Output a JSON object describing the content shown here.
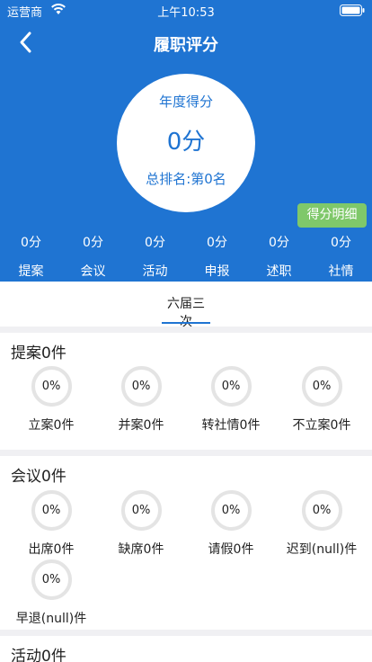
{
  "status": {
    "carrier": "运营商",
    "time": "上午10:53"
  },
  "nav": {
    "title": "履职评分"
  },
  "score": {
    "year_label": "年度得分",
    "year_value": "0分",
    "rank": "总排名:第0名"
  },
  "detail_button": "得分明细",
  "categories": [
    {
      "value": "0分",
      "name": "提案"
    },
    {
      "value": "0分",
      "name": "会议"
    },
    {
      "value": "0分",
      "name": "活动"
    },
    {
      "value": "0分",
      "name": "申报"
    },
    {
      "value": "0分",
      "name": "述职"
    },
    {
      "value": "0分",
      "name": "社情"
    }
  ],
  "tabs": [
    {
      "label": "六届三次"
    }
  ],
  "sections": [
    {
      "title": "提案0件",
      "items": [
        {
          "percent": "0%",
          "label": "立案0件"
        },
        {
          "percent": "0%",
          "label": "并案0件"
        },
        {
          "percent": "0%",
          "label": "转社情0件"
        },
        {
          "percent": "0%",
          "label": "不立案0件"
        }
      ]
    },
    {
      "title": "会议0件",
      "items": [
        {
          "percent": "0%",
          "label": "出席0件"
        },
        {
          "percent": "0%",
          "label": "缺席0件"
        },
        {
          "percent": "0%",
          "label": "请假0件"
        },
        {
          "percent": "0%",
          "label": "迟到(null)件"
        },
        {
          "percent": "0%",
          "label": "早退(null)件"
        }
      ]
    },
    {
      "title": "活动0件"
    }
  ]
}
